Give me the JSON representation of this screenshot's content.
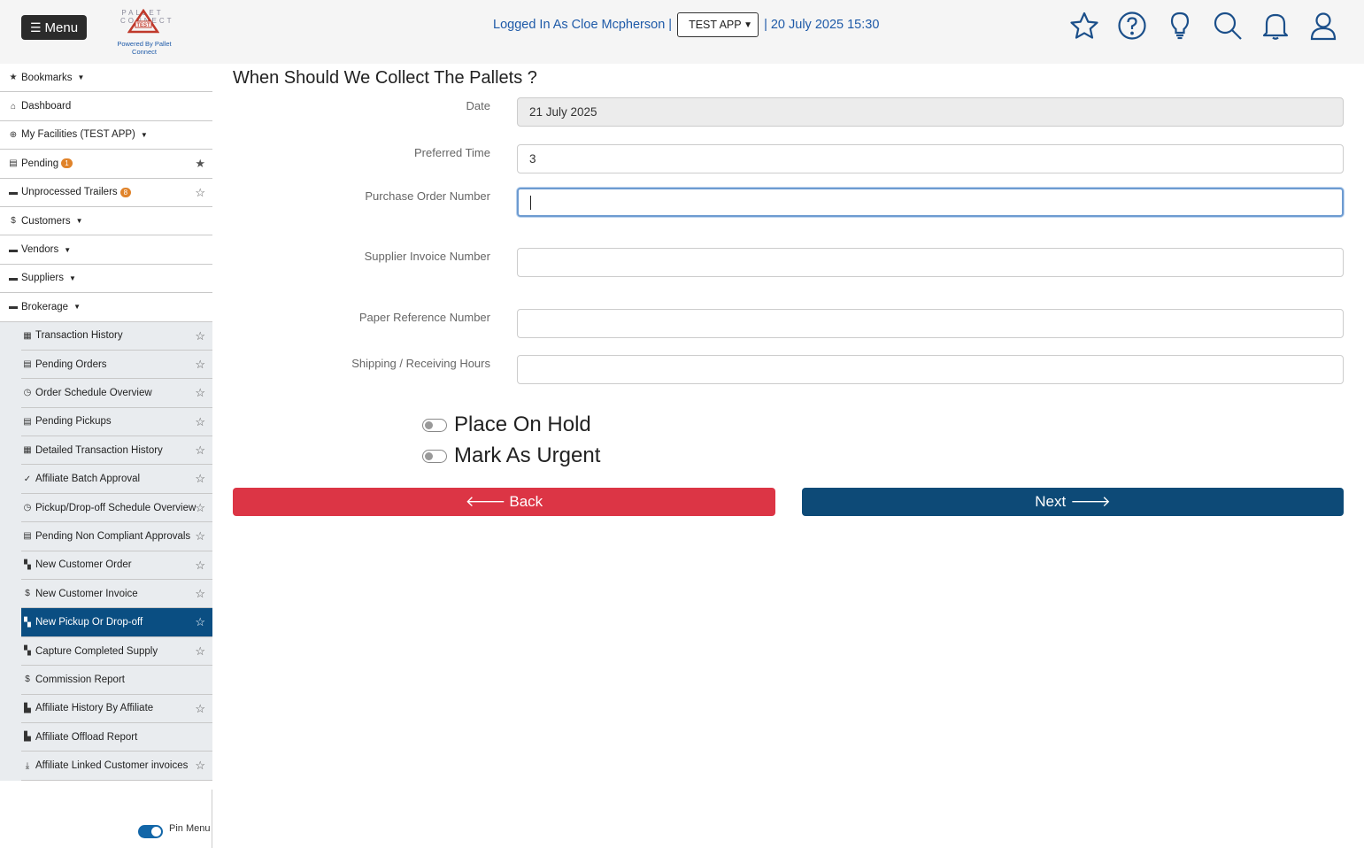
{
  "header": {
    "menu_label": "Menu",
    "logo_top_text": "PALLET CONNECT",
    "logo_stamp": "TEST",
    "logo_caption": "Powered By Pallet Connect",
    "logged_in_text": "Logged In As Cloe Mcpherson |",
    "app_select_value": "TEST APP",
    "datetime_text": "| 20 July 2025 15:30",
    "icons": [
      "star-icon",
      "help-icon",
      "lightbulb-icon",
      "search-icon",
      "bell-icon",
      "user-icon"
    ]
  },
  "sidebar": {
    "top_items": [
      {
        "label": "Bookmarks",
        "icon": "★"
      },
      {
        "label": "Dashboard",
        "icon": "⌂"
      },
      {
        "label": "My Facilities (TEST APP)",
        "icon": "⊕"
      },
      {
        "label": "Pending",
        "icon": "▤",
        "badge": "1"
      },
      {
        "label": "Unprocessed Trailers",
        "icon": "▬",
        "badge": "8"
      },
      {
        "label": "Customers",
        "icon": "$"
      },
      {
        "label": "Vendors",
        "icon": "▬"
      },
      {
        "label": "Suppliers",
        "icon": "▬"
      },
      {
        "label": "Brokerage",
        "icon": "▬"
      }
    ],
    "sub_items": [
      {
        "label": "Transaction History",
        "icon": "▦"
      },
      {
        "label": "Pending Orders",
        "icon": "▤"
      },
      {
        "label": "Order Schedule Overview",
        "icon": "◷"
      },
      {
        "label": "Pending Pickups",
        "icon": "▤"
      },
      {
        "label": "Detailed Transaction History",
        "icon": "▦"
      },
      {
        "label": "Affiliate Batch Approval",
        "icon": "✓"
      },
      {
        "label": "Pickup/Drop-off Schedule Overview",
        "icon": "◷"
      },
      {
        "label": "Pending Non Compliant Approvals",
        "icon": "▤"
      },
      {
        "label": "New Customer Order",
        "icon": "▚"
      },
      {
        "label": "New Customer Invoice",
        "icon": "$"
      },
      {
        "label": "New Pickup Or Drop-off",
        "icon": "▚"
      },
      {
        "label": "Capture Completed Supply",
        "icon": "▚"
      },
      {
        "label": "Commission Report",
        "icon": "$"
      },
      {
        "label": "Affiliate History By Affiliate",
        "icon": "▙"
      },
      {
        "label": "Affiliate Offload Report",
        "icon": "▙"
      },
      {
        "label": "Affiliate Linked Customer invoices",
        "icon": "⤓"
      }
    ],
    "pin_menu_label": "Pin Menu"
  },
  "main": {
    "title": "When Should We Collect The Pallets ?",
    "fields": [
      {
        "label": "Date",
        "value": "21 July 2025"
      },
      {
        "label": "Preferred Time",
        "value": "3"
      },
      {
        "label": "Purchase Order Number",
        "value": ""
      },
      {
        "label": "Supplier Invoice Number",
        "value": ""
      },
      {
        "label": "Paper Reference Number",
        "value": ""
      },
      {
        "label": "Shipping / Receiving Hours",
        "value": ""
      }
    ],
    "toggles": [
      "Place On Hold",
      "Mark As Urgent"
    ],
    "back_label": "Back",
    "next_label": "Next"
  }
}
